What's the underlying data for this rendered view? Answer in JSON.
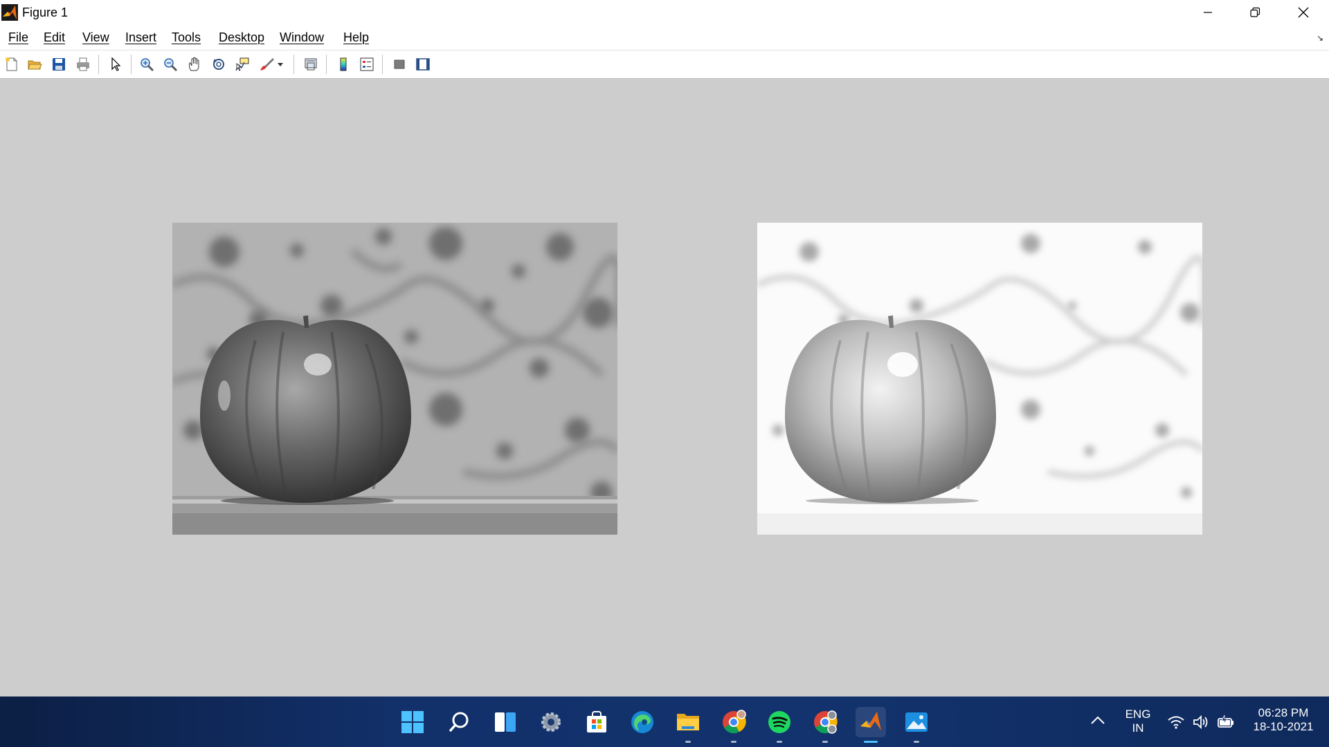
{
  "window": {
    "title": "Figure 1",
    "controls": [
      "minimize",
      "restore",
      "close"
    ]
  },
  "menu": {
    "items": [
      "File",
      "Edit",
      "View",
      "Insert",
      "Tools",
      "Desktop",
      "Window",
      "Help"
    ]
  },
  "toolbar": {
    "icons": [
      "new-figure-icon",
      "open-file-icon",
      "save-icon",
      "print-icon",
      "pointer-icon",
      "zoom-in-icon",
      "zoom-out-icon",
      "pan-icon",
      "rotate-3d-icon",
      "data-cursor-icon",
      "brush-icon",
      "brush-dropdown-icon",
      "link-plot-icon",
      "colorbar-icon",
      "legend-icon",
      "hide-plot-tools-icon",
      "show-plot-tools-icon"
    ]
  },
  "figure": {
    "images": [
      {
        "name": "original-grayscale-apple",
        "kind": "grayscale photo of an apple"
      },
      {
        "name": "processed-apple",
        "kind": "brightened / enhanced grayscale photo of an apple"
      }
    ]
  },
  "taskbar": {
    "apps": [
      "start",
      "search",
      "widgets",
      "settings",
      "store",
      "edge",
      "file-explorer",
      "chrome-profile-1",
      "spotify",
      "chrome-profile-2",
      "matlab",
      "photos"
    ],
    "active_app": "matlab",
    "tray": {
      "lang_top": "ENG",
      "lang_bottom": "IN",
      "time": "06:28 PM",
      "date": "18-10-2021"
    }
  },
  "colors": {
    "figure_bg": "#cdcdcd",
    "taskbar_bg": "#12306a",
    "accent": "#4cc2ff"
  }
}
